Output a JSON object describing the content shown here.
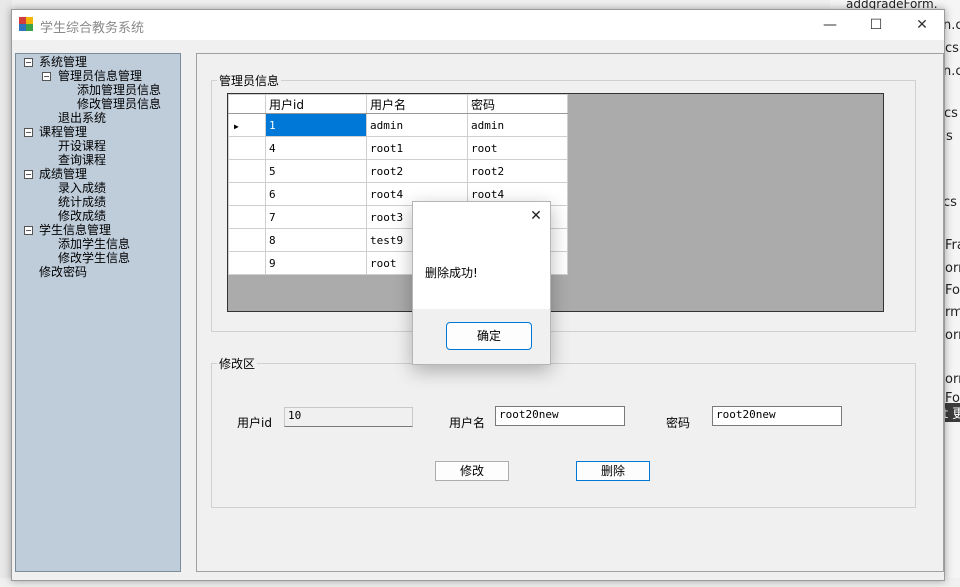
{
  "background": {
    "right_snippets": [
      "addgradeForm.",
      "n.cs",
      "cs",
      "n.cs",
      "cs",
      "s",
      "cs",
      "Fra",
      "orm",
      "Fo",
      "rm",
      "orm",
      "orm",
      "Fo",
      "t 更"
    ]
  },
  "window": {
    "title": "学生综合教务系统",
    "minimize": "—",
    "maximize": "☐",
    "close": "✕"
  },
  "tree": {
    "nodes": [
      {
        "label": "系统管理",
        "toggle": "−"
      },
      {
        "label": "管理员信息管理",
        "toggle": "−"
      },
      {
        "label": "添加管理员信息"
      },
      {
        "label": "修改管理员信息"
      },
      {
        "label": "退出系统"
      },
      {
        "label": "课程管理",
        "toggle": "−"
      },
      {
        "label": "开设课程"
      },
      {
        "label": "查询课程"
      },
      {
        "label": "成绩管理",
        "toggle": "−"
      },
      {
        "label": "录入成绩"
      },
      {
        "label": "统计成绩"
      },
      {
        "label": "修改成绩"
      },
      {
        "label": "学生信息管理",
        "toggle": "−"
      },
      {
        "label": "添加学生信息"
      },
      {
        "label": "修改学生信息"
      },
      {
        "label": "修改密码"
      }
    ]
  },
  "admin_info": {
    "title": "管理员信息",
    "columns": [
      "用户id",
      "用户名",
      "密码"
    ],
    "current_row_marker": "▶",
    "rows": [
      [
        "1",
        "admin",
        "admin"
      ],
      [
        "4",
        "root1",
        "root"
      ],
      [
        "5",
        "root2",
        "root2"
      ],
      [
        "6",
        "root4",
        "root4"
      ],
      [
        "7",
        "root3",
        ""
      ],
      [
        "8",
        "test9",
        ""
      ],
      [
        "9",
        "root",
        ""
      ]
    ]
  },
  "edit_area": {
    "title": "修改区",
    "id_label": "用户id",
    "id_value": "10",
    "name_label": "用户名",
    "name_value": "root20new",
    "pwd_label": "密码",
    "pwd_value": "root20new",
    "modify_button": "修改",
    "delete_button": "删除"
  },
  "dialog": {
    "message": "删除成功!",
    "ok_button": "确定",
    "close": "✕"
  }
}
